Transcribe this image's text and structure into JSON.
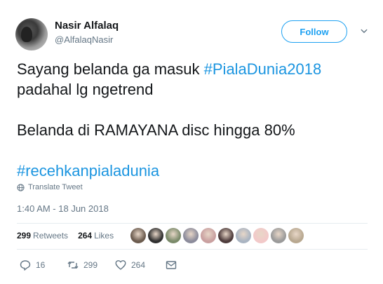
{
  "user": {
    "name": "Nasir Alfalaq",
    "handle": "@AlfalaqNasir"
  },
  "follow_label": "Follow",
  "tweet": {
    "line1_text": "Sayang belanda ga masuk ",
    "line1_hashtag": "#PialaDunia2018",
    "line2": "padahal lg ngetrend",
    "line3": "Belanda di RAMAYANA disc hingga 80%",
    "hashtag2": "#recehkanpialadunia"
  },
  "translate_label": "Translate Tweet",
  "timestamp": "1:40 AM - 18 Jun 2018",
  "stats": {
    "retweets_count": "299",
    "retweets_label": "Retweets",
    "likes_count": "264",
    "likes_label": "Likes"
  },
  "likers": [
    {
      "color": "#6b5b4e"
    },
    {
      "color": "#2f2f2f"
    },
    {
      "color": "#7a8a6a"
    },
    {
      "color": "#8b8b9b"
    },
    {
      "color": "#c9a0a0"
    },
    {
      "color": "#4d3b3b"
    },
    {
      "color": "#a9b4c2"
    },
    {
      "color": "#f2c9c9"
    },
    {
      "color": "#9a9a9a"
    },
    {
      "color": "#b8a890"
    }
  ],
  "actions": {
    "reply_count": "16",
    "retweet_count": "299",
    "like_count": "264"
  },
  "colors": {
    "accent": "#1da1f2",
    "hashtag": "#1b95e0",
    "secondary_text": "#657786"
  }
}
